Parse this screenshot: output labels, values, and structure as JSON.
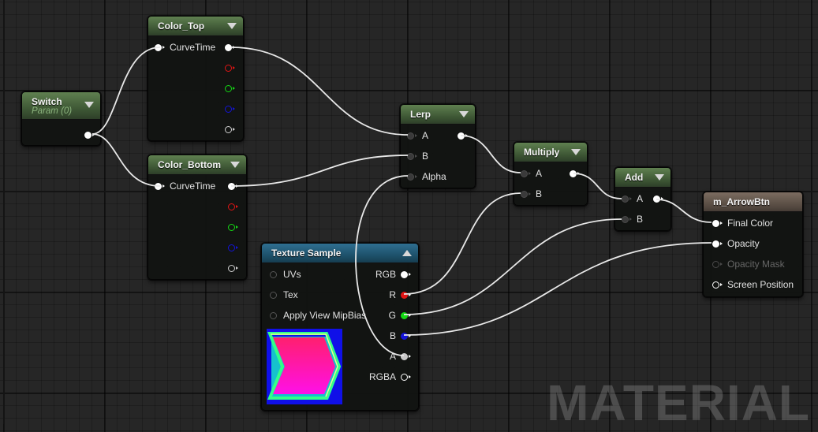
{
  "watermark": "MATERIAL",
  "nodes": {
    "switch": {
      "title": "Switch",
      "subtitle": "Param (0)"
    },
    "color_top": {
      "title": "Color_Top",
      "input": "CurveTime"
    },
    "color_bottom": {
      "title": "Color_Bottom",
      "input": "CurveTime"
    },
    "lerp": {
      "title": "Lerp",
      "inputs": [
        "A",
        "B",
        "Alpha"
      ]
    },
    "multiply": {
      "title": "Multiply",
      "inputs": [
        "A",
        "B"
      ]
    },
    "add": {
      "title": "Add",
      "inputs": [
        "A",
        "B"
      ]
    },
    "texture_sample": {
      "title": "Texture Sample",
      "inputs": [
        "UVs",
        "Tex",
        "Apply View MipBias"
      ],
      "outputs": [
        "RGB",
        "R",
        "G",
        "B",
        "A",
        "RGBA"
      ]
    },
    "result": {
      "title": "m_ArrowBtn",
      "inputs": [
        "Final Color",
        "Opacity",
        "Opacity Mask",
        "Screen Position"
      ]
    }
  },
  "colors": {
    "header_green": "#3d5634",
    "header_blue": "#1d5069",
    "header_brown": "#5a4e45",
    "pin_red": "#e01515",
    "pin_green": "#14d914",
    "pin_blue": "#1414d8",
    "wire": "#e8e8e8"
  }
}
